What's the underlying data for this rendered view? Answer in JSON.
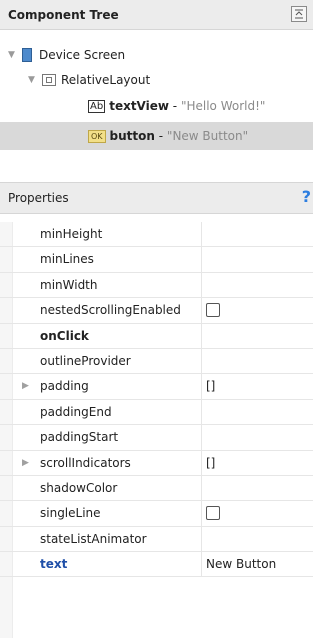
{
  "component_tree": {
    "title": "Component Tree",
    "nodes": [
      {
        "label": "Device Screen"
      },
      {
        "label": "RelativeLayout"
      },
      {
        "icon_text": "Ab",
        "name": "textView",
        "separator": " - ",
        "value": "\"Hello World!\""
      },
      {
        "icon_text": "OK",
        "name": "button",
        "separator": " - ",
        "value": "\"New Button\""
      }
    ]
  },
  "properties": {
    "title": "Properties",
    "help_icon": "?",
    "rows": [
      {
        "name": "minHeight",
        "value": ""
      },
      {
        "name": "minLines",
        "value": ""
      },
      {
        "name": "minWidth",
        "value": ""
      },
      {
        "name": "nestedScrollingEnabled",
        "value": "",
        "checkbox": true
      },
      {
        "name": "onClick",
        "value": "",
        "bold": true
      },
      {
        "name": "outlineProvider",
        "value": ""
      },
      {
        "name": "padding",
        "value": "[]",
        "expandable": true
      },
      {
        "name": "paddingEnd",
        "value": ""
      },
      {
        "name": "paddingStart",
        "value": ""
      },
      {
        "name": "scrollIndicators",
        "value": "[]",
        "expandable": true
      },
      {
        "name": "shadowColor",
        "value": ""
      },
      {
        "name": "singleLine",
        "value": "",
        "checkbox": true
      },
      {
        "name": "stateListAnimator",
        "value": ""
      },
      {
        "name": "text",
        "value": "New Button",
        "bold": true,
        "highlight": true
      }
    ]
  },
  "colors": {
    "header_bg": "#ececec",
    "selection_bg": "#d9d9d9",
    "highlight_text": "#1f4fa8"
  }
}
